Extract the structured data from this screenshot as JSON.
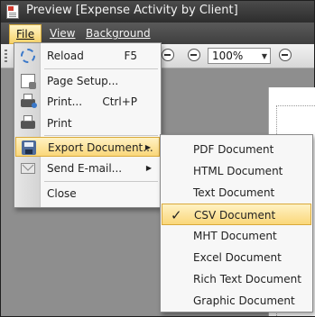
{
  "window": {
    "title": "Preview [Expense Activity by Client]"
  },
  "menubar": {
    "file": "File",
    "view": "View",
    "background": "Background"
  },
  "toolbar": {
    "zoom": "100%"
  },
  "file_menu": {
    "items": [
      {
        "label": "Reload",
        "shortcut": "F5",
        "icon": "reload-icon"
      },
      {
        "label": "Page Setup...",
        "shortcut": "",
        "icon": "page-setup-icon"
      },
      {
        "label": "Print...",
        "shortcut": "Ctrl+P",
        "icon": "print-dialog-icon"
      },
      {
        "label": "Print",
        "shortcut": "",
        "icon": "print-icon"
      },
      {
        "label": "Export Document...",
        "shortcut": "",
        "icon": "export-icon",
        "submenu": true,
        "highlighted": true
      },
      {
        "label": "Send E-mail...",
        "shortcut": "",
        "icon": "email-icon",
        "submenu": true
      },
      {
        "label": "Close",
        "shortcut": "",
        "icon": ""
      }
    ]
  },
  "export_submenu": {
    "items": [
      {
        "label": "PDF Document"
      },
      {
        "label": "HTML Document"
      },
      {
        "label": "Text Document"
      },
      {
        "label": "CSV Document",
        "checked": true,
        "highlighted": true
      },
      {
        "label": "MHT Document"
      },
      {
        "label": "Excel Document"
      },
      {
        "label": "Rich Text Document"
      },
      {
        "label": "Graphic Document"
      }
    ]
  },
  "glyphs": {
    "check": "✓",
    "submenu_arrow": "▶",
    "dropdown_arrow": "▼"
  },
  "colors": {
    "highlight_top": "#fff2c4",
    "highlight_bottom": "#fad77a",
    "highlight_border": "#d9a93a",
    "titlebar": "#3a3a3a"
  }
}
